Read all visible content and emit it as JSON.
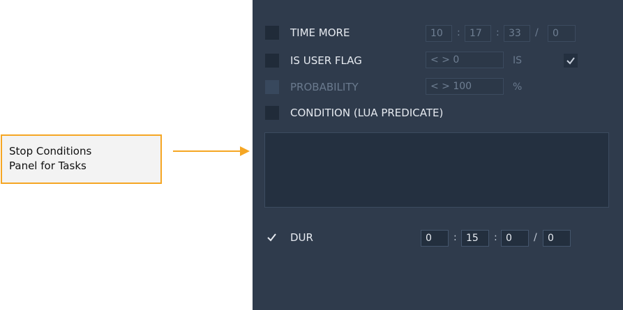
{
  "callout": {
    "line1": "Stop Conditions",
    "line2": "Panel for Tasks"
  },
  "colors": {
    "panel_bg": "#2f3b4c",
    "callout_border": "#f5a623",
    "arrow": "#f5a623"
  },
  "time_more": {
    "label": "TIME MORE",
    "h": "10",
    "m": "17",
    "s": "33",
    "d": "0",
    "sep_colon": ":",
    "sep_slash": "/"
  },
  "user_flag": {
    "label": "IS USER FLAG",
    "value": "< > 0",
    "is_label": "IS"
  },
  "probability": {
    "label": "PROBABILITY",
    "value": "< > 100",
    "unit": "%"
  },
  "condition": {
    "label": "CONDITION (LUA PREDICATE)"
  },
  "dur": {
    "label": "DUR",
    "h": "0",
    "m": "15",
    "s": "0",
    "d": "0"
  },
  "icons": {
    "checkmark": "check-icon",
    "arrow": "arrow-right-icon"
  }
}
